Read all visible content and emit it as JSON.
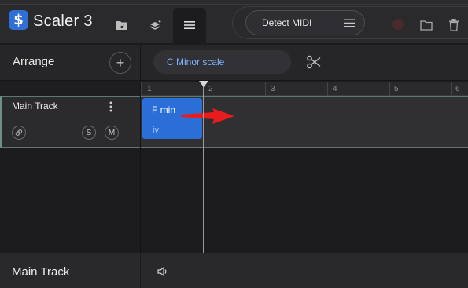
{
  "header": {
    "logo_glyph": "$",
    "app_title": "Scaler 3",
    "tabs": [
      {
        "icon": "folder-music-icon"
      },
      {
        "icon": "layers-sparkle-icon"
      },
      {
        "icon": "menu-lines-icon",
        "active": true
      }
    ],
    "detect_midi_label": "Detect MIDI",
    "icons": [
      "record-dot-icon",
      "folder-icon",
      "trash-icon"
    ]
  },
  "arrange": {
    "label": "Arrange",
    "add_label": "+",
    "scale_label": "C Minor scale"
  },
  "ruler": {
    "bars": [
      "1",
      "2",
      "3",
      "4",
      "5",
      "6"
    ]
  },
  "track": {
    "name": "Main Track",
    "solo_label": "S",
    "mute_label": "M",
    "chord": {
      "name": "F min",
      "roman": "iv"
    }
  },
  "bottom": {
    "title": "Main Track"
  },
  "colors": {
    "accent": "#2f6fd6",
    "chord_block": "#2b6ed8",
    "scale_text": "#7fb3ff",
    "annotation_arrow": "#e81c1c"
  }
}
